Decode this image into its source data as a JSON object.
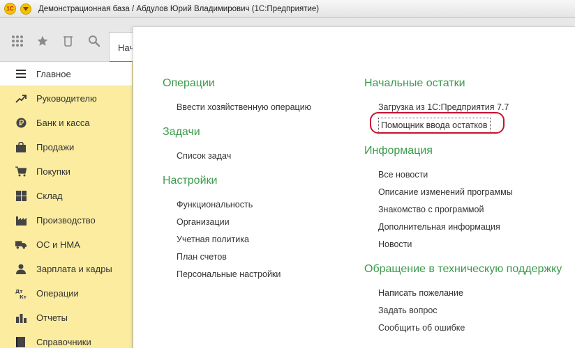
{
  "window": {
    "title": "Демонстрационная база / Абдулов Юрий Владимирович  (1С:Предприятие)",
    "logo_text": "1С"
  },
  "toolbar": {
    "tools": [
      "apps-grid-icon",
      "star-icon",
      "history-icon",
      "search-icon"
    ],
    "tab_label": "Нач"
  },
  "sidebar": {
    "items": [
      {
        "label": "Главное",
        "icon": "menu-lines-icon",
        "active": true
      },
      {
        "label": "Руководителю",
        "icon": "trend-up-icon"
      },
      {
        "label": "Банк и касса",
        "icon": "ruble-coin-icon"
      },
      {
        "label": "Продажи",
        "icon": "shopping-bag-icon"
      },
      {
        "label": "Покупки",
        "icon": "shopping-cart-icon"
      },
      {
        "label": "Склад",
        "icon": "warehouse-grid-icon"
      },
      {
        "label": "Производство",
        "icon": "factory-icon"
      },
      {
        "label": "ОС и НМА",
        "icon": "truck-icon"
      },
      {
        "label": "Зарплата и кадры",
        "icon": "person-icon"
      },
      {
        "label": "Операции",
        "icon": "debit-credit-icon"
      },
      {
        "label": "Отчеты",
        "icon": "bar-chart-icon"
      },
      {
        "label": "Справочники",
        "icon": "book-icon"
      }
    ]
  },
  "main": {
    "left_sections": [
      {
        "title": "Операции",
        "links": [
          "Ввести хозяйственную операцию"
        ]
      },
      {
        "title": "Задачи",
        "links": [
          "Список задач"
        ]
      },
      {
        "title": "Настройки",
        "links": [
          "Функциональность",
          "Организации",
          "Учетная политика",
          "План счетов",
          "Персональные настройки"
        ]
      }
    ],
    "right_sections": [
      {
        "title": "Начальные остатки",
        "links": [
          "Загрузка из 1С:Предприятия 7.7",
          "Помощник ввода остатков"
        ]
      },
      {
        "title": "Информация",
        "links": [
          "Все новости",
          "Описание изменений программы",
          "Знакомство с программой",
          "Дополнительная информация",
          "Новости"
        ]
      },
      {
        "title": "Обращение в техническую поддержку",
        "links": [
          "Написать пожелание",
          "Задать вопрос",
          "Сообщить об ошибке"
        ]
      }
    ]
  },
  "colors": {
    "accent_green": "#3c9b4d",
    "sidebar_bg": "#fbeca0",
    "highlight_red": "#c8102e"
  }
}
